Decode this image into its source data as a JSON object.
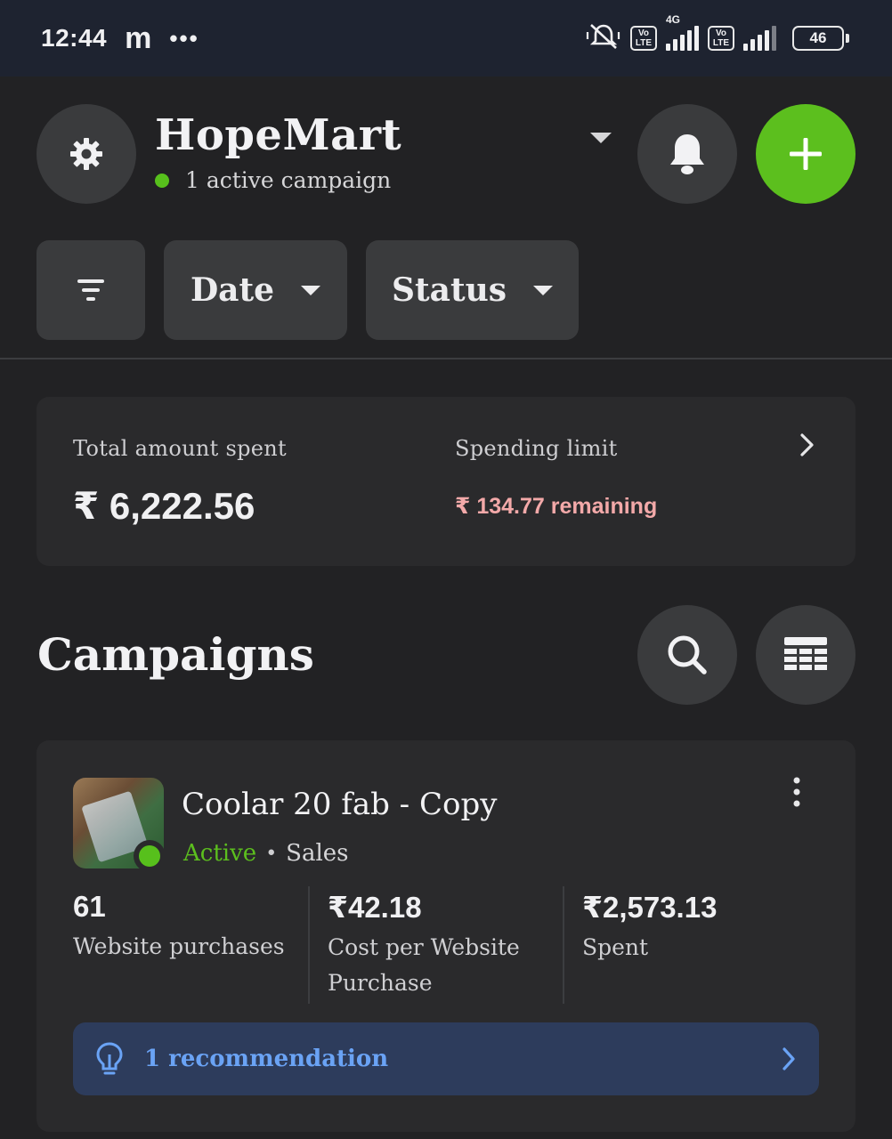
{
  "status_bar": {
    "time": "12:44",
    "app_icon": "m",
    "more": "•••",
    "network": "4G",
    "sim1_label": [
      "Vo",
      "LTE"
    ],
    "sim2_label": [
      "Vo",
      "LTE"
    ],
    "battery": "46"
  },
  "header": {
    "account_name": "HopeMart",
    "active_campaigns": "1 active campaign",
    "accent_green": "#5cbf1e"
  },
  "filters": {
    "date_label": "Date",
    "status_label": "Status"
  },
  "summary": {
    "total_label": "Total amount spent",
    "total_value": "₹ 6,222.56",
    "limit_label": "Spending limit",
    "limit_value": "₹ 134.77 remaining"
  },
  "campaigns": {
    "title": "Campaigns",
    "items": [
      {
        "name": "Coolar 20 fab - Copy",
        "status": "Active",
        "separator": "•",
        "objective": "Sales",
        "metrics": [
          {
            "value": "61",
            "label": "Website purchases"
          },
          {
            "value": "₹42.18",
            "label": "Cost per Website Purchase"
          },
          {
            "value": "₹2,573.13",
            "label": "Spent"
          }
        ],
        "recommendation": "1 recommendation"
      }
    ]
  }
}
